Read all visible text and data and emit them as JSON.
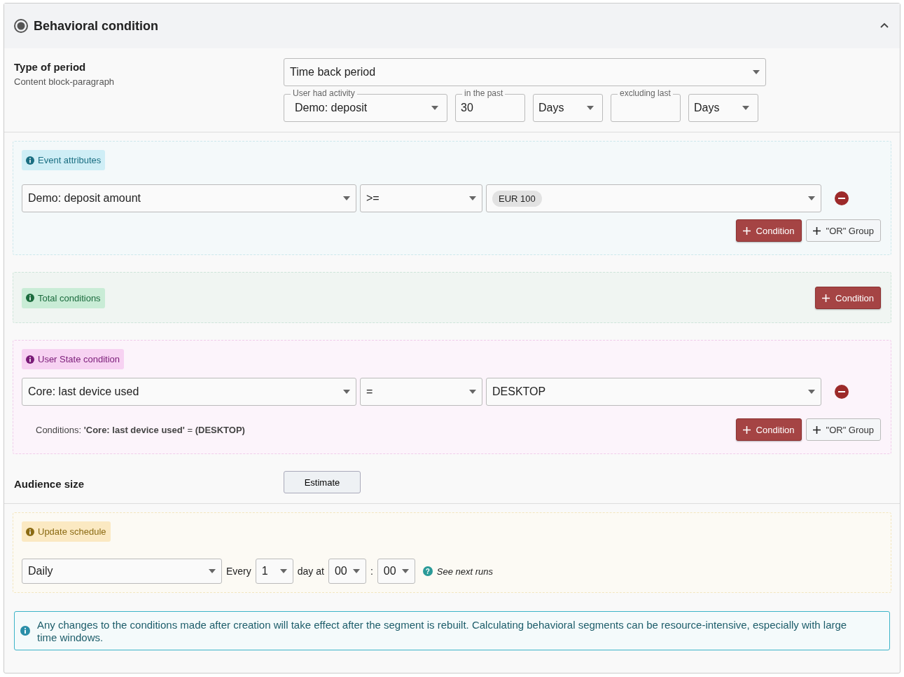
{
  "header": {
    "title": "Behavioral condition",
    "expanded": true
  },
  "period": {
    "label": "Type of period",
    "sublabel": "Content block-paragraph",
    "type_value": "Time back period",
    "fields": [
      {
        "kind": "select",
        "label": "User had activity",
        "value": "Demo: deposit"
      },
      {
        "kind": "input",
        "label": "in the past",
        "value": "30"
      },
      {
        "kind": "select",
        "value": "Days"
      },
      {
        "kind": "input",
        "label": "excluding last"
      },
      {
        "kind": "select",
        "value": "Days"
      }
    ]
  },
  "groups": [
    {
      "kind": "event",
      "title": "Event attributes",
      "rows": [
        {
          "attribute": "Demo: deposit amount",
          "operator": ">=",
          "chips": [
            "EUR 100"
          ]
        }
      ],
      "buttons": [
        {
          "kind": "primary",
          "label": "Condition"
        },
        {
          "kind": "secondary",
          "label": "\"OR\" Group"
        }
      ]
    },
    {
      "kind": "total",
      "title": "Total conditions",
      "buttons": [
        {
          "kind": "primary",
          "label": "Condition"
        }
      ]
    },
    {
      "kind": "state",
      "title": "User State condition",
      "rows": [
        {
          "attribute": "Core: last device used",
          "operator": "=",
          "value": "DESKTOP"
        }
      ],
      "summary": "Conditions: **'Core: last device used'** = **(DESKTOP)**",
      "buttons": [
        {
          "kind": "primary",
          "label": "Condition"
        },
        {
          "kind": "secondary",
          "label": "\"OR\" Group"
        }
      ]
    }
  ],
  "audience": {
    "label": "Audience size",
    "button": "Estimate"
  },
  "schedule": {
    "title": "Update schedule",
    "frequency": "Daily",
    "every_label": "Every",
    "every_value": "1",
    "day_at_label": "day at",
    "hour": "00",
    "separator": ":",
    "minute": "00",
    "help_icon": "?",
    "link": "See next runs"
  },
  "notice": "Any changes to the conditions made after creation will take effect after the segment is rebuilt. Calculating behavioral segments can be resource-intensive, especially with large time windows."
}
